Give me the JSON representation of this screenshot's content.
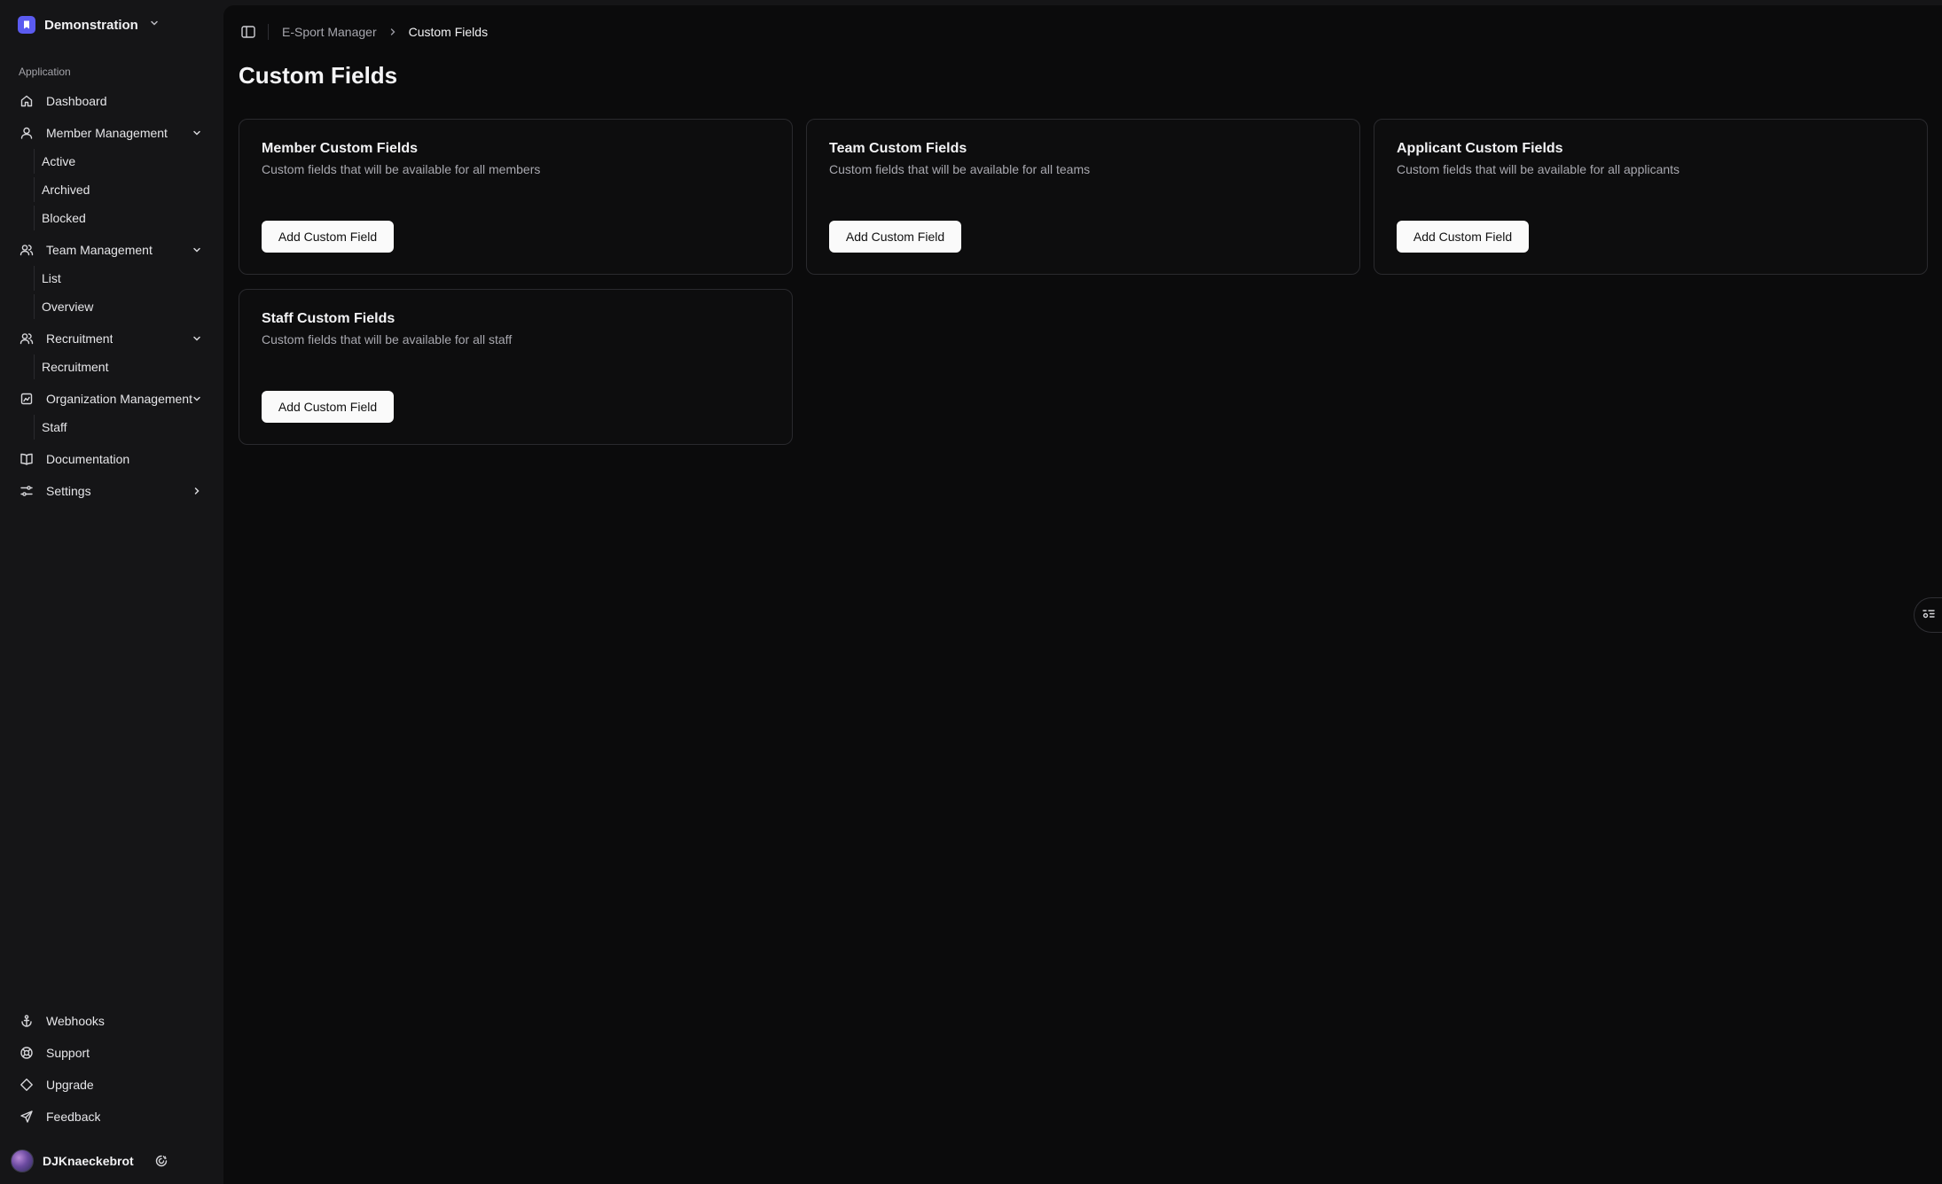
{
  "workspace": {
    "name": "Demonstration"
  },
  "sidebar": {
    "group_label": "Application",
    "items": [
      {
        "label": "Dashboard",
        "icon": "home-icon"
      },
      {
        "label": "Member Management",
        "icon": "user-icon",
        "sub": [
          "Active",
          "Archived",
          "Blocked"
        ]
      },
      {
        "label": "Team Management",
        "icon": "users-icon",
        "sub": [
          "List",
          "Overview"
        ]
      },
      {
        "label": "Recruitment",
        "icon": "user-plus-icon",
        "sub": [
          "Recruitment"
        ]
      },
      {
        "label": "Organization Management",
        "icon": "building-icon",
        "sub": [
          "Staff"
        ]
      },
      {
        "label": "Documentation",
        "icon": "book-icon"
      },
      {
        "label": "Settings",
        "icon": "sliders-icon"
      }
    ],
    "footer": [
      {
        "label": "Webhooks",
        "icon": "anchor-icon"
      },
      {
        "label": "Support",
        "icon": "lifebuoy-icon"
      },
      {
        "label": "Upgrade",
        "icon": "diamond-icon"
      },
      {
        "label": "Feedback",
        "icon": "send-icon"
      }
    ],
    "user": {
      "name": "DJKnaeckebrot"
    }
  },
  "breadcrumb": {
    "parent": "E-Sport Manager",
    "current": "Custom Fields"
  },
  "page": {
    "title": "Custom Fields"
  },
  "cards": [
    {
      "title": "Member Custom Fields",
      "description": "Custom fields that will be available for all members",
      "button": "Add Custom Field"
    },
    {
      "title": "Team Custom Fields",
      "description": "Custom fields that will be available for all teams",
      "button": "Add Custom Field"
    },
    {
      "title": "Applicant Custom Fields",
      "description": "Custom fields that will be available for all applicants",
      "button": "Add Custom Field"
    },
    {
      "title": "Staff Custom Fields",
      "description": "Custom fields that will be available for all staff",
      "button": "Add Custom Field"
    }
  ],
  "colors": {
    "accent": "#5b5bf0",
    "background": "#0b0b0c",
    "sidebar": "#151517"
  }
}
